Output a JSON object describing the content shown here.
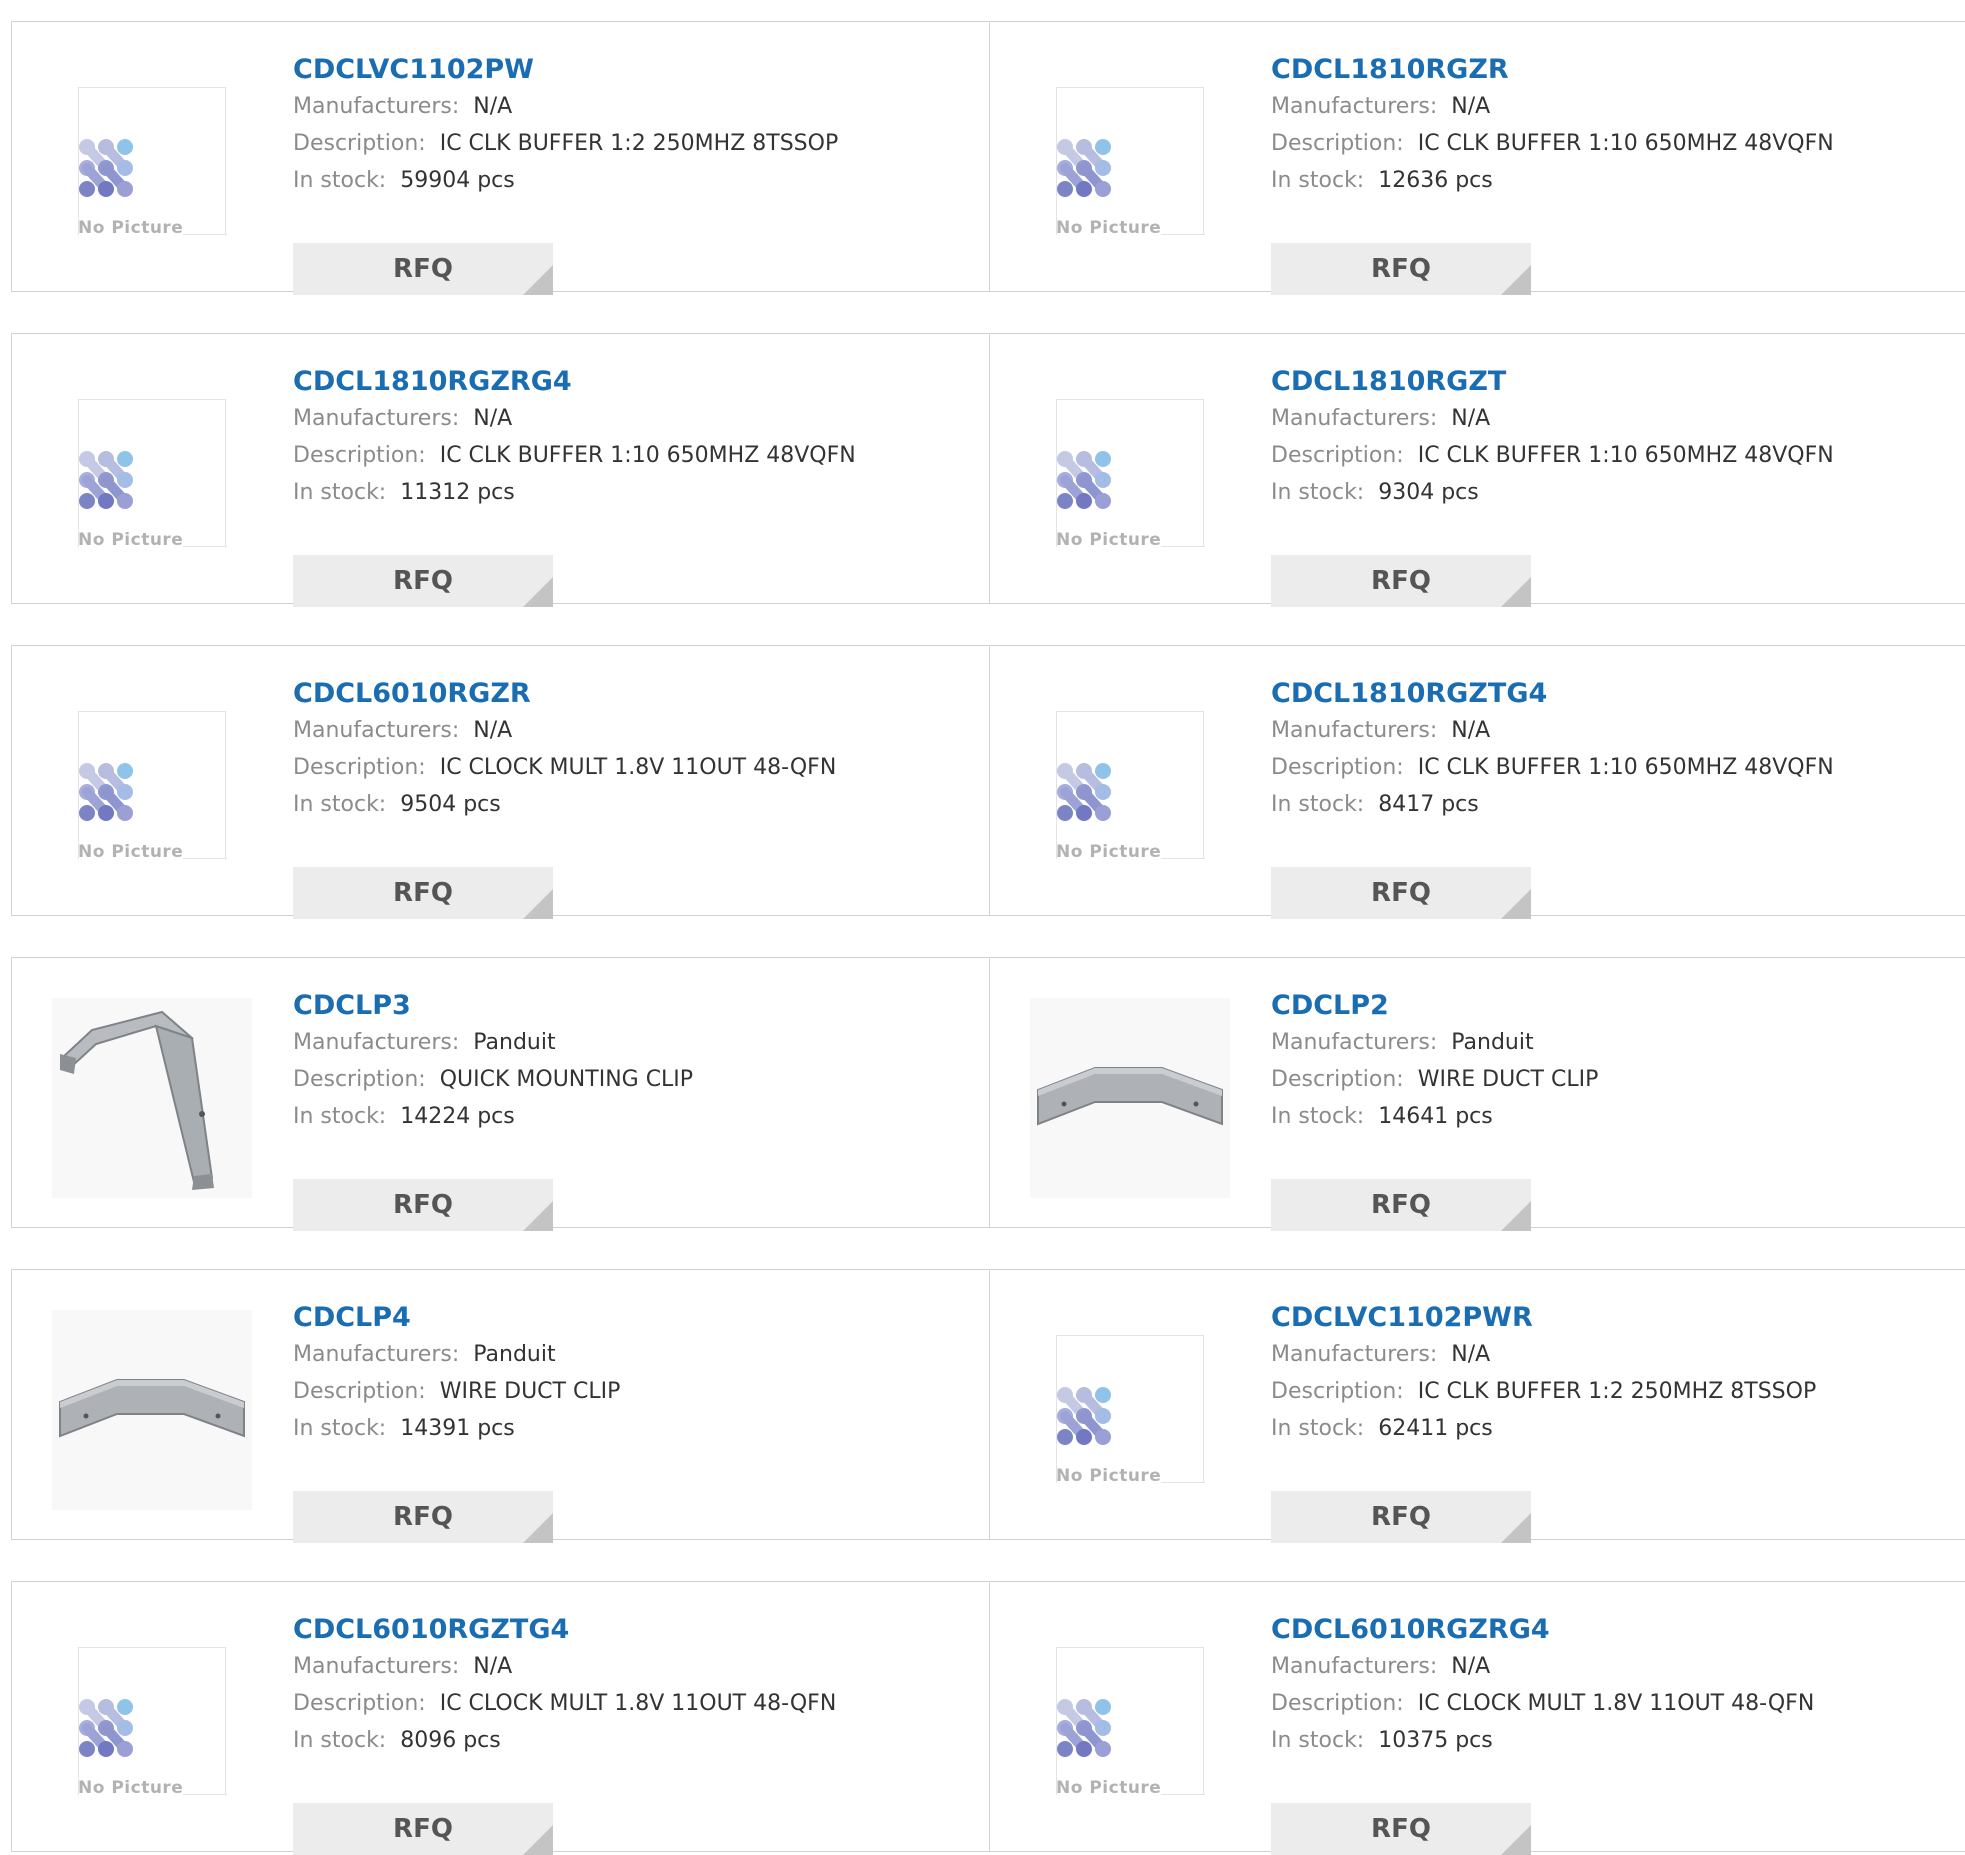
{
  "labels": {
    "manufacturers": "Manufacturers:",
    "description": "Description:",
    "in_stock": "In stock:",
    "rfq": "RFQ",
    "no_picture": "No Picture"
  },
  "colors": {
    "part_link": "#1a6db0",
    "label_gray": "#8b8b8b",
    "value_dark": "#333333",
    "rfq_bg": "#ececec"
  },
  "products": [
    {
      "name": "CDCLVC1102PW",
      "manufacturer": "N/A",
      "description": "IC CLK BUFFER 1:2 250MHZ 8TSSOP",
      "stock": "59904 pcs",
      "image": "no-picture-icon"
    },
    {
      "name": "CDCL1810RGZR",
      "manufacturer": "N/A",
      "description": "IC CLK BUFFER 1:10 650MHZ 48VQFN",
      "stock": "12636 pcs",
      "image": "no-picture-icon"
    },
    {
      "name": "CDCL1810RGZRG4",
      "manufacturer": "N/A",
      "description": "IC CLK BUFFER 1:10 650MHZ 48VQFN",
      "stock": "11312 pcs",
      "image": "no-picture-icon"
    },
    {
      "name": "CDCL1810RGZT",
      "manufacturer": "N/A",
      "description": "IC CLK BUFFER 1:10 650MHZ 48VQFN",
      "stock": "9304 pcs",
      "image": "no-picture-icon"
    },
    {
      "name": "CDCL6010RGZR",
      "manufacturer": "N/A",
      "description": "IC CLOCK MULT 1.8V 11OUT 48-QFN",
      "stock": "9504 pcs",
      "image": "no-picture-icon"
    },
    {
      "name": "CDCL1810RGZTG4",
      "manufacturer": "N/A",
      "description": "IC CLK BUFFER 1:10 650MHZ 48VQFN",
      "stock": "8417 pcs",
      "image": "no-picture-icon"
    },
    {
      "name": "CDCLP3",
      "manufacturer": "Panduit",
      "description": "QUICK MOUNTING CLIP",
      "stock": "14224 pcs",
      "image": "mounting-clip-photo"
    },
    {
      "name": "CDCLP2",
      "manufacturer": "Panduit",
      "description": "WIRE DUCT CLIP",
      "stock": "14641 pcs",
      "image": "wire-duct-clip-photo"
    },
    {
      "name": "CDCLP4",
      "manufacturer": "Panduit",
      "description": "WIRE DUCT CLIP",
      "stock": "14391 pcs",
      "image": "wire-duct-clip-photo"
    },
    {
      "name": "CDCLVC1102PWR",
      "manufacturer": "N/A",
      "description": "IC CLK BUFFER 1:2 250MHZ 8TSSOP",
      "stock": "62411 pcs",
      "image": "no-picture-icon"
    },
    {
      "name": "CDCL6010RGZTG4",
      "manufacturer": "N/A",
      "description": "IC CLOCK MULT 1.8V 11OUT 48-QFN",
      "stock": "8096 pcs",
      "image": "no-picture-icon"
    },
    {
      "name": "CDCL6010RGZRG4",
      "manufacturer": "N/A",
      "description": "IC CLOCK MULT 1.8V 11OUT 48-QFN",
      "stock": "10375 pcs",
      "image": "no-picture-icon"
    }
  ]
}
